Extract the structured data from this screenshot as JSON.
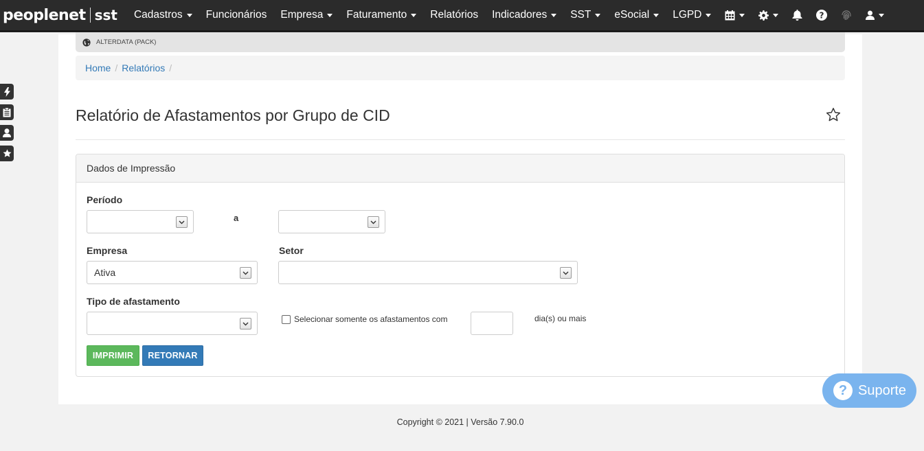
{
  "brand": {
    "name": "peoplenet",
    "suffix": "sst"
  },
  "nav": {
    "items": [
      {
        "label": "Cadastros",
        "dropdown": true
      },
      {
        "label": "Funcionários",
        "dropdown": false
      },
      {
        "label": "Empresa",
        "dropdown": true
      },
      {
        "label": "Faturamento",
        "dropdown": true
      },
      {
        "label": "Relatórios",
        "dropdown": false
      },
      {
        "label": "Indicadores",
        "dropdown": true
      },
      {
        "label": "SST",
        "dropdown": true
      },
      {
        "label": "eSocial",
        "dropdown": true
      },
      {
        "label": "LGPD",
        "dropdown": true
      }
    ],
    "icons": [
      "calendar-icon",
      "gear-icon",
      "bell-icon",
      "help-icon",
      "fingerprint-icon",
      "user-icon"
    ]
  },
  "sidebar": {
    "buttons": [
      "bolt-icon",
      "clipboard-icon",
      "user-icon",
      "star-icon"
    ]
  },
  "info_bar": {
    "text": "ALTERDATA (PACK)",
    "icon": "globe-icon"
  },
  "breadcrumb": {
    "home": "Home",
    "current": "Relatórios",
    "separator": "/"
  },
  "page": {
    "title": "Relatório de Afastamentos por Grupo de CID",
    "favorite_icon": "star-outline-icon"
  },
  "panel": {
    "heading": "Dados de Impressão",
    "periodo_label": "Período",
    "periodo_sep": "a",
    "periodo_start": "",
    "periodo_end": "",
    "empresa_label": "Empresa",
    "empresa_value": "Ativa",
    "setor_label": "Setor",
    "setor_value": "",
    "tipo_label": "Tipo de afastamento",
    "tipo_value": "",
    "checkbox_label": "Selecionar somente os afastamentos com",
    "dias_value": "",
    "dias_suffix": "dia(s) ou mais",
    "print_button": "IMPRIMIR",
    "return_button": "RETORNAR"
  },
  "footer": {
    "text": "Copyright © 2021 | Versão 7.90.0"
  },
  "support": {
    "label": "Suporte",
    "color": "#7ab4ee"
  },
  "colors": {
    "navbar": "#2b2b2b",
    "link": "#337ab7",
    "success": "#5cb85c",
    "primary": "#337ab7"
  }
}
